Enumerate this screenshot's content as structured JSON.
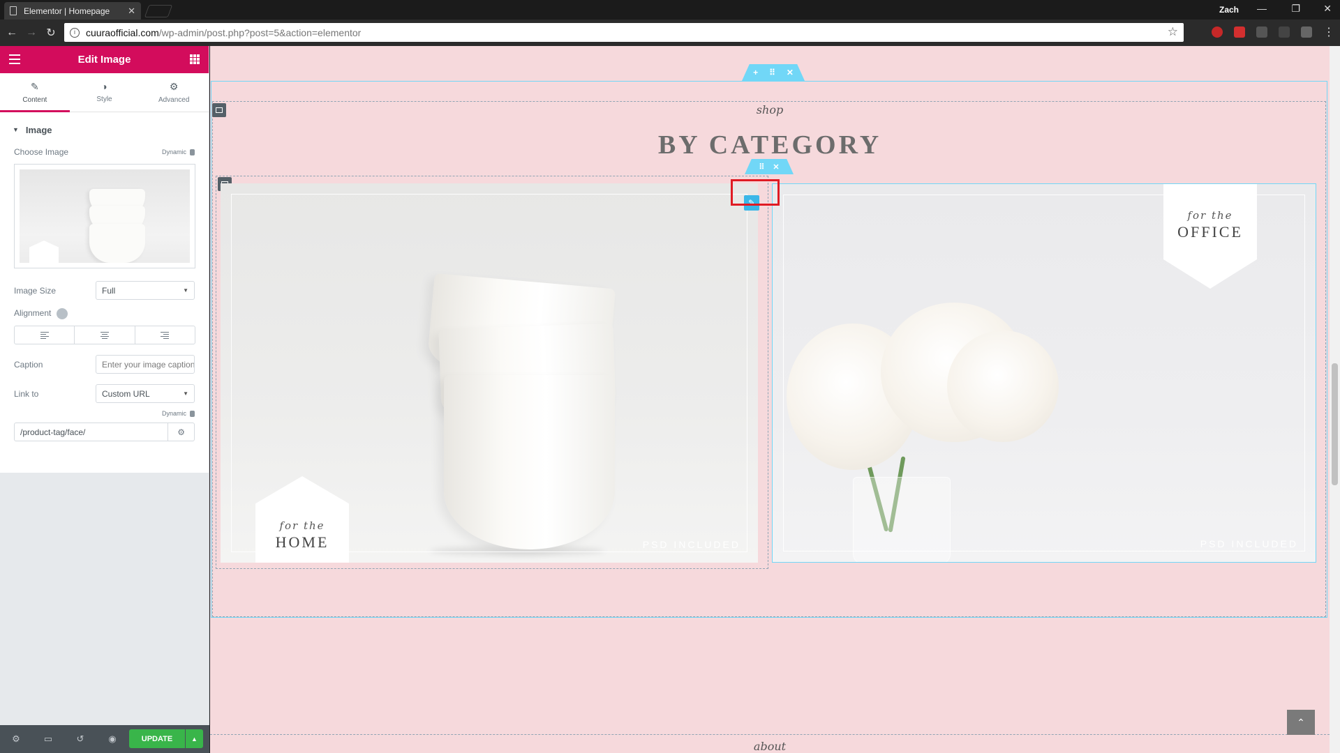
{
  "browser": {
    "tab_title": "Elementor | Homepage",
    "user": "Zach",
    "url_host": "cuuraofficial.com",
    "url_path": "/wp-admin/post.php?post=5&action=elementor"
  },
  "sidebar": {
    "header_title": "Edit Image",
    "tabs": [
      {
        "label": "Content",
        "icon": "pencil-icon"
      },
      {
        "label": "Style",
        "icon": "half-circle-icon"
      },
      {
        "label": "Advanced",
        "icon": "gear-icon"
      }
    ],
    "section_title": "Image",
    "choose_image_label": "Choose Image",
    "dynamic_label": "Dynamic",
    "image_size_label": "Image Size",
    "image_size_value": "Full",
    "alignment_label": "Alignment",
    "caption_label": "Caption",
    "caption_placeholder": "Enter your image caption",
    "link_to_label": "Link to",
    "link_to_value": "Custom URL",
    "url_value": "/product-tag/face/",
    "update_label": "UPDATE"
  },
  "canvas": {
    "shop_label": "shop",
    "title": "BY CATEGORY",
    "cards": [
      {
        "small": "for the",
        "big": "HOME",
        "badge": "PSD INCLUDED"
      },
      {
        "small": "for the",
        "big": "OFFICE",
        "badge": "PSD INCLUDED"
      }
    ],
    "about_label": "about"
  },
  "colors": {
    "brand": "#d30c5c",
    "canvas_bg": "#f6d9dc",
    "handle": "#71d7f7",
    "update_green": "#39b54a",
    "highlight_red": "#e01b24"
  }
}
